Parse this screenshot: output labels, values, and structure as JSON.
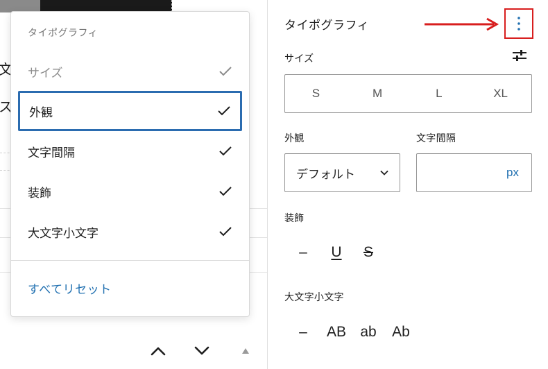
{
  "canvas": {
    "text_fragments": [
      "文",
      "ス"
    ]
  },
  "menu": {
    "title": "タイポグラフィ",
    "items": [
      {
        "label": "サイズ",
        "checked": true,
        "disabled": true
      },
      {
        "label": "外観",
        "checked": true,
        "focused": true
      },
      {
        "label": "文字間隔",
        "checked": true
      },
      {
        "label": "装飾",
        "checked": true
      },
      {
        "label": "大文字小文字",
        "checked": true
      }
    ],
    "reset_label": "すべてリセット"
  },
  "panel": {
    "title": "タイポグラフィ",
    "size": {
      "label": "サイズ",
      "options": [
        "S",
        "M",
        "L",
        "XL"
      ]
    },
    "appearance": {
      "label": "外観",
      "value": "デフォルト"
    },
    "letter_spacing": {
      "label": "文字間隔",
      "value": "",
      "unit": "px"
    },
    "decoration": {
      "label": "装飾",
      "options": [
        "–",
        "U",
        "S"
      ]
    },
    "letter_case": {
      "label": "大文字小文字",
      "options": [
        "–",
        "AB",
        "ab",
        "Ab"
      ]
    }
  },
  "colors": {
    "accent": "#2271b1",
    "annotation": "#d81e1e",
    "border": "#949494"
  }
}
